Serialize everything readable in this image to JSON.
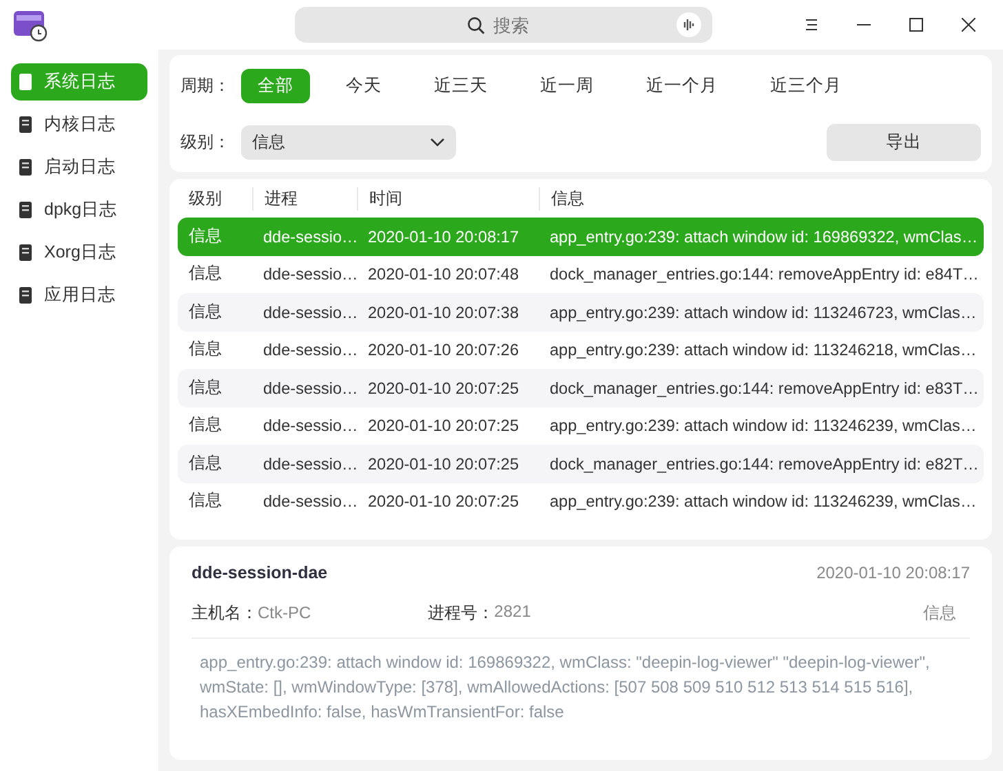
{
  "window": {
    "search_placeholder": "搜索"
  },
  "sidebar": {
    "items": [
      {
        "label": "系统日志",
        "selected": true
      },
      {
        "label": "内核日志",
        "selected": false
      },
      {
        "label": "启动日志",
        "selected": false
      },
      {
        "label": "dpkg日志",
        "selected": false
      },
      {
        "label": "Xorg日志",
        "selected": false
      },
      {
        "label": "应用日志",
        "selected": false
      }
    ]
  },
  "filters": {
    "period_label": "周期：",
    "periods": [
      {
        "label": "全部",
        "selected": true
      },
      {
        "label": "今天",
        "selected": false
      },
      {
        "label": "近三天",
        "selected": false
      },
      {
        "label": "近一周",
        "selected": false
      },
      {
        "label": "近一个月",
        "selected": false
      },
      {
        "label": "近三个月",
        "selected": false
      }
    ],
    "level_label": "级别：",
    "level_value": "信息",
    "export_button": "导出"
  },
  "table": {
    "columns": [
      "级别",
      "进程",
      "时间",
      "信息"
    ],
    "rows": [
      {
        "level": "信息",
        "process": "dde-sessio…",
        "time": "2020-01-10 20:08:17",
        "message": "app_entry.go:239: attach window id: 169869322, wmClas…",
        "selected": true
      },
      {
        "level": "信息",
        "process": "dde-sessio…",
        "time": "2020-01-10 20:07:48",
        "message": "dock_manager_entries.go:144: removeAppEntry id: e84T…",
        "selected": false
      },
      {
        "level": "信息",
        "process": "dde-sessio…",
        "time": "2020-01-10 20:07:38",
        "message": "app_entry.go:239: attach window id: 113246723, wmClas…",
        "selected": false
      },
      {
        "level": "信息",
        "process": "dde-sessio…",
        "time": "2020-01-10 20:07:26",
        "message": "app_entry.go:239: attach window id: 113246218, wmClas…",
        "selected": false
      },
      {
        "level": "信息",
        "process": "dde-sessio…",
        "time": "2020-01-10 20:07:25",
        "message": "dock_manager_entries.go:144: removeAppEntry id: e83T…",
        "selected": false
      },
      {
        "level": "信息",
        "process": "dde-sessio…",
        "time": "2020-01-10 20:07:25",
        "message": "app_entry.go:239: attach window id: 113246239, wmClas…",
        "selected": false
      },
      {
        "level": "信息",
        "process": "dde-sessio…",
        "time": "2020-01-10 20:07:25",
        "message": "dock_manager_entries.go:144: removeAppEntry id: e82T…",
        "selected": false
      },
      {
        "level": "信息",
        "process": "dde-sessio…",
        "time": "2020-01-10 20:07:25",
        "message": "app_entry.go:239: attach window id: 113246239, wmClas…",
        "selected": false
      }
    ]
  },
  "detail": {
    "process": "dde-session-dae",
    "time": "2020-01-10 20:08:17",
    "host_label": "主机名：",
    "host": "Ctk-PC",
    "pid_label": "进程号：",
    "pid": "2821",
    "level": "信息",
    "message": "app_entry.go:239: attach window id: 169869322, wmClass: \"deepin-log-viewer\" \"deepin-log-viewer\", wmState: [], wmWindowType: [378], wmAllowedActions: [507 508 509 510 512 513 514 515 516], hasXEmbedInfo: false, hasWmTransientFor: false"
  }
}
